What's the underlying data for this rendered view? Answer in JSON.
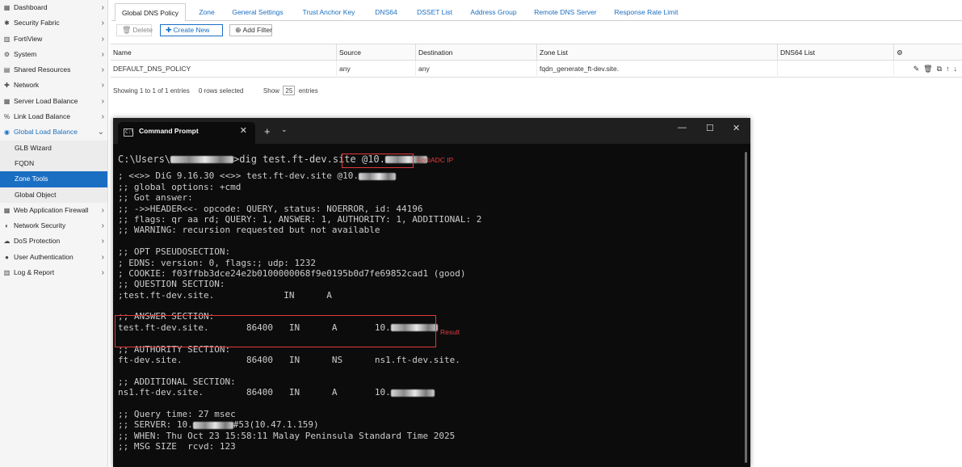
{
  "sidebar": {
    "items": [
      {
        "icon": "▦",
        "icon_name": "dashboard-icon",
        "label": "Dashboard"
      },
      {
        "icon": "✱",
        "icon_name": "security-fabric-icon",
        "label": "Security Fabric"
      },
      {
        "icon": "▥",
        "icon_name": "fortiview-icon",
        "label": "FortiView"
      },
      {
        "icon": "⚙",
        "icon_name": "system-gear-icon",
        "label": "System"
      },
      {
        "icon": "▤",
        "icon_name": "shared-resources-icon",
        "label": "Shared Resources"
      },
      {
        "icon": "✚",
        "icon_name": "network-icon",
        "label": "Network"
      },
      {
        "icon": "▦",
        "icon_name": "server-load-balance-icon",
        "label": "Server Load Balance"
      },
      {
        "icon": "%",
        "icon_name": "link-load-balance-icon",
        "label": "Link Load Balance"
      },
      {
        "icon": "◉",
        "icon_name": "globe-icon",
        "label": "Global Load Balance"
      },
      {
        "label": "GLB Wizard"
      },
      {
        "label": "FQDN"
      },
      {
        "label": "Zone Tools"
      },
      {
        "label": "Global Object"
      },
      {
        "icon": "▦",
        "icon_name": "web-application-firewall-icon",
        "label": "Web Application Firewall"
      },
      {
        "icon": "◐",
        "icon_name": "shield-icon",
        "label": "Network Security"
      },
      {
        "icon": "☁",
        "icon_name": "cloud-icon",
        "label": "DoS Protection"
      },
      {
        "icon": "●",
        "icon_name": "user-icon",
        "label": "User Authentication"
      },
      {
        "icon": "▥",
        "icon_name": "log-report-icon",
        "label": "Log & Report"
      }
    ]
  },
  "tabs": [
    "Global DNS Policy",
    "Zone",
    "General Settings",
    "Trust Anchor Key",
    "DNS64",
    "DSSET List",
    "Address Group",
    "Remote DNS Server",
    "Response Rate Limit"
  ],
  "toolbar": {
    "delete": "Delete",
    "delete_icon": "🗑",
    "create_new": "Create New",
    "create_icon": "✚",
    "add_filter": "Add Filter",
    "filter_icon": "⊕"
  },
  "table": {
    "columns": [
      "Name",
      "Source",
      "Destination",
      "Zone List",
      "DNS64 List"
    ],
    "settings_icon": "⚙",
    "rows": [
      {
        "name": "DEFAULT_DNS_POLICY",
        "source": "any",
        "destination": "any",
        "zone_list": "fqdn_generate_ft-dev.site.",
        "dns64_list": ""
      }
    ],
    "row_icons": {
      "edit": "✎",
      "delete": "🗑",
      "clone": "⧉",
      "up": "↑",
      "down": "↓"
    }
  },
  "entries": {
    "showing": "Showing 1 to 1 of 1 entries",
    "selected": "0 rows selected",
    "show": "Show",
    "page_size": "25",
    "entries_word": "entries"
  },
  "cmd": {
    "tab_title": "Command Prompt",
    "tab_icon": "C:\\",
    "close": "✕",
    "new_tab": "+",
    "dropdown": "⌄",
    "minimize": "—",
    "maximize": "☐",
    "window_close": "✕",
    "line_prompt_a": "C:\\Users\\",
    "line_prompt_b": ">dig test.ft-dev.site ",
    "line_prompt_c": "@10.",
    "line_dig_a": "; <<>> DiG 9.16.30 <<>> test.ft-dev.site @10.",
    "line_global": ";; global options: +cmd",
    "line_got": ";; Got answer:",
    "line_header": ";; ->>HEADER<<- opcode: QUERY, status: NOERROR, id: 44196",
    "line_flags": ";; flags: qr aa rd; QUERY: 1, ANSWER: 1, AUTHORITY: 1, ADDITIONAL: 2",
    "line_warning": ";; WARNING: recursion requested but not available",
    "line_opt": ";; OPT PSEUDOSECTION:",
    "line_edns": "; EDNS: version: 0, flags:; udp: 1232",
    "line_cookie": "; COOKIE: f03ffbb3dce24e2b0100000068f9e0195b0d7fe69852cad1 (good)",
    "line_question": ";; QUESTION SECTION:",
    "line_question_rec": ";test.ft-dev.site.             IN      A",
    "line_answer": ";; ANSWER SECTION:",
    "line_answer_rec": "test.ft-dev.site.       86400   IN      A       10.",
    "line_authority": ";; AUTHORITY SECTION:",
    "line_authority_rec": "ft-dev.site.            86400   IN      NS      ns1.ft-dev.site.",
    "line_additional": ";; ADDITIONAL SECTION:",
    "line_additional_rec": "ns1.ft-dev.site.        86400   IN      A       10.",
    "line_qtime": ";; Query time: 27 msec",
    "line_server_a": ";; SERVER: 10.",
    "line_server_b": "#53(10.47.1.159)",
    "line_when": ";; WHEN: Thu Oct 23 15:58:11 Malay Peninsula Standard Time 2025",
    "line_msgsize": ";; MSG SIZE  rcvd: 123"
  },
  "annotations": {
    "fortiadc_ip": "FortiADC IP",
    "result": "Result"
  },
  "colors": {
    "accent": "#1b6fc2",
    "annotation": "#e03a3a",
    "terminal_bg": "#0c0c0c",
    "terminal_text": "#cccccc"
  }
}
